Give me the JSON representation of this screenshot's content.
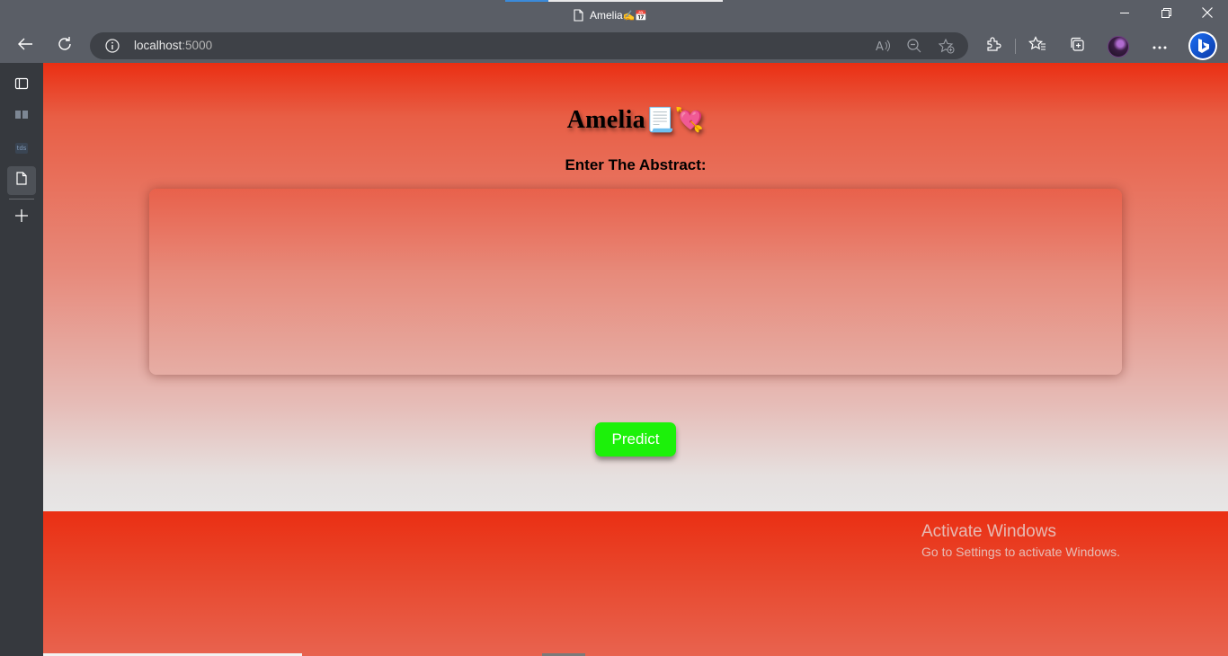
{
  "browser": {
    "tab": {
      "title": "Amelia",
      "title_emoji": "✍️📅",
      "page_icon": "document-icon"
    },
    "address": {
      "host": "localhost",
      "port": ":5000"
    },
    "toolbar_icons": [
      "back-icon",
      "refresh-icon",
      "info-icon",
      "read-aloud-icon",
      "zoom-out-icon",
      "add-favorite-icon",
      "extensions-icon",
      "favorites-icon",
      "collections-icon",
      "profile-avatar",
      "more-icon",
      "bing-icon"
    ],
    "window_controls": [
      "minimize-icon",
      "restore-icon",
      "close-icon"
    ]
  },
  "sidebar": {
    "items": [
      "tab-actions-icon",
      "book-icon",
      "tds-icon",
      "page-icon",
      "add-icon"
    ],
    "tds_label": "tds"
  },
  "page": {
    "title": "Amelia",
    "title_emojis": "📃💘",
    "label": "Enter The Abstract:",
    "abstract": {
      "value": "",
      "placeholder": ""
    },
    "predict_button": "Predict",
    "colors": {
      "header_red": "#ea2f13",
      "button_green": "#1cf10a",
      "fade_light": "#e7e6e6"
    }
  },
  "os_watermark": {
    "line1": "Activate Windows",
    "line2": "Go to Settings to activate Windows."
  }
}
